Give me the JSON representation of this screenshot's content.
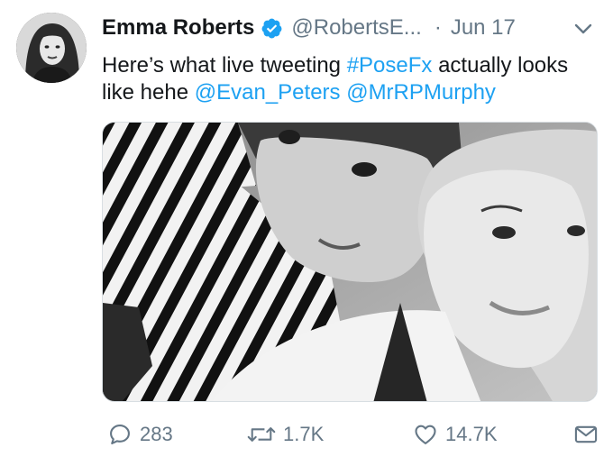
{
  "tweet": {
    "author": {
      "name": "Emma Roberts",
      "handle": "@RobertsE...",
      "verified": true
    },
    "separator": "·",
    "date": "Jun 17",
    "text": {
      "part1": "Here’s what live tweeting ",
      "hashtag": "#PoseFx",
      "part2": " actually looks like hehe ",
      "mention1": "@Evan_Peters",
      "space": " ",
      "mention2": "@MrRPMurphy"
    },
    "media": {
      "kind": "black-and-white selfie photo"
    },
    "actions": {
      "replies": "283",
      "retweets": "1.7K",
      "likes": "14.7K"
    }
  },
  "colors": {
    "link": "#1da1f2",
    "secondary_text": "#657786",
    "verified_badge": "#1da1f2",
    "primary_text": "#14171a"
  },
  "icons": [
    "verified-badge-icon",
    "chevron-down-icon",
    "reply-icon",
    "retweet-icon",
    "like-icon",
    "direct-message-icon"
  ]
}
